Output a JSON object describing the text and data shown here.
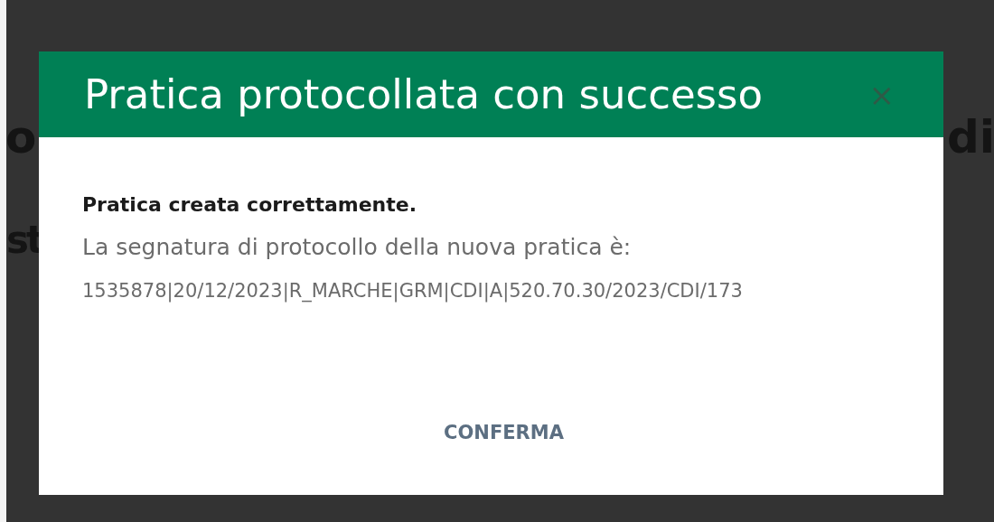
{
  "background_text": {
    "left_line_1": "o",
    "left_line_2": "st",
    "right_line_1": "di"
  },
  "dialog": {
    "title": "Pratica protocollata con successo",
    "close": "×",
    "heading": "Pratica creata correttamente.",
    "message": "La segnatura di protocollo della nuova pratica è:",
    "protocol": "1535878|20/12/2023|R_MARCHE|GRM|CDI|A|520.70.30/2023/CDI/173",
    "confirm_button": "CONFERMA"
  }
}
